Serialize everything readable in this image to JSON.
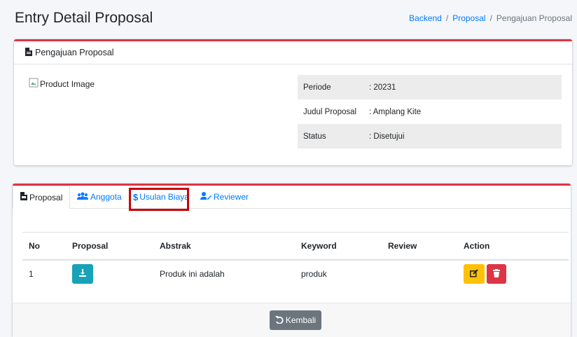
{
  "header": {
    "title": "Entry Detail Proposal"
  },
  "breadcrumb": [
    "Backend",
    "Proposal",
    "Pengajuan Proposal"
  ],
  "detail_card": {
    "title": "Pengajuan Proposal",
    "image_alt": "Product Image",
    "rows": [
      {
        "label": "Periode",
        "value": ": 20231"
      },
      {
        "label": "Judul Proposal",
        "value": ": Amplang Kite"
      },
      {
        "label": "Status",
        "value": ": Disetujui"
      }
    ]
  },
  "tabs": [
    {
      "label": "Proposal",
      "icon": "file-pdf-icon",
      "active": true
    },
    {
      "label": "Anggota",
      "icon": "users-icon"
    },
    {
      "label": "Usulan Biaya",
      "icon": "dollar-icon",
      "highlighted": true
    },
    {
      "label": "Reviewer",
      "icon": "user-edit-icon"
    }
  ],
  "table": {
    "headers": [
      "No",
      "Proposal",
      "Abstrak",
      "Keyword",
      "Review",
      "Action"
    ],
    "rows": [
      {
        "no": "1",
        "abstrak": "Produk ini adalah",
        "keyword": "produk",
        "review": ""
      }
    ]
  },
  "footer": {
    "back_label": "Kembali"
  },
  "colors": {
    "accent": "#dc3545",
    "link": "#007bff",
    "info": "#17a2b8",
    "warning": "#ffc107",
    "secondary": "#6c757d",
    "highlight": "#cc0000"
  }
}
